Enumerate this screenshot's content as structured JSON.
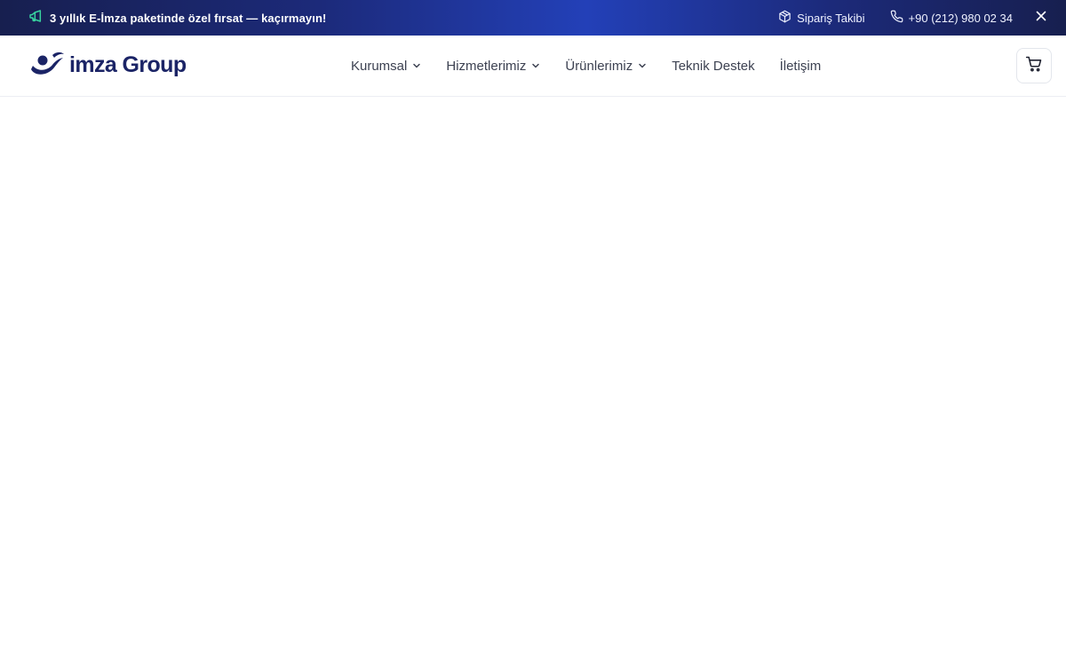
{
  "colors": {
    "topbar_dark": "#171f4f",
    "topbar_mid": "#2340b8",
    "brand_navy": "#1b2466",
    "nav_text": "#3d4252",
    "promo_icon": "#38d39f"
  },
  "announcement": {
    "icon": "megaphone-icon",
    "text": "3 yıllık E-İmza paketinde özel fırsat — kaçırmayın!"
  },
  "topbar": {
    "order_tracking": {
      "icon": "package-icon",
      "label": "Sipariş Takibi"
    },
    "phone": {
      "icon": "phone-icon",
      "label": "+90 (212) 980 02 34"
    },
    "close_icon": "close-icon"
  },
  "header": {
    "logo": {
      "text": "imza Group"
    },
    "nav": [
      {
        "label": "Kurumsal",
        "has_dropdown": true
      },
      {
        "label": "Hizmetlerimiz",
        "has_dropdown": true
      },
      {
        "label": "Ürünlerimiz",
        "has_dropdown": true
      },
      {
        "label": "Teknik Destek",
        "has_dropdown": false
      },
      {
        "label": "İletişim",
        "has_dropdown": false
      }
    ],
    "cart_icon": "cart-icon"
  }
}
